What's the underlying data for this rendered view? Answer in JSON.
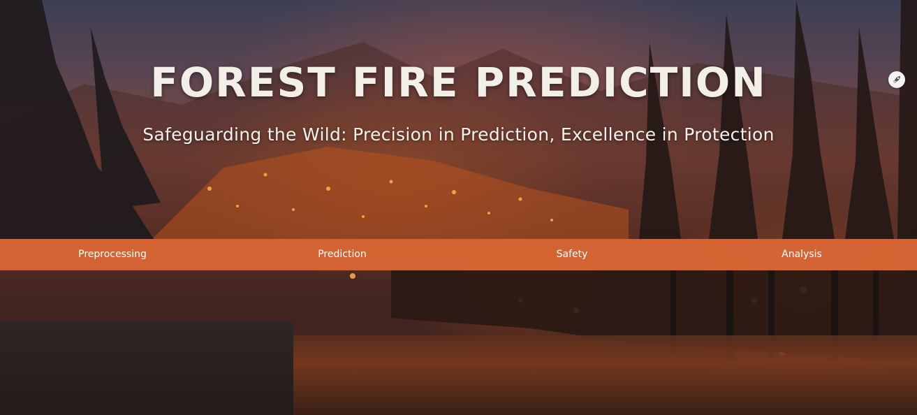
{
  "hero": {
    "title": "FOREST FIRE PREDICTION",
    "subtitle": "Safeguarding the Wild: Precision in Prediction, Excellence in Protection"
  },
  "nav": {
    "items": [
      {
        "label": "Preprocessing"
      },
      {
        "label": "Prediction"
      },
      {
        "label": "Safety"
      },
      {
        "label": "Analysis"
      }
    ]
  },
  "colors": {
    "navbar": "#da6634",
    "text": "#ffffff"
  },
  "icons": {
    "floating_badge": "rocket-icon"
  }
}
